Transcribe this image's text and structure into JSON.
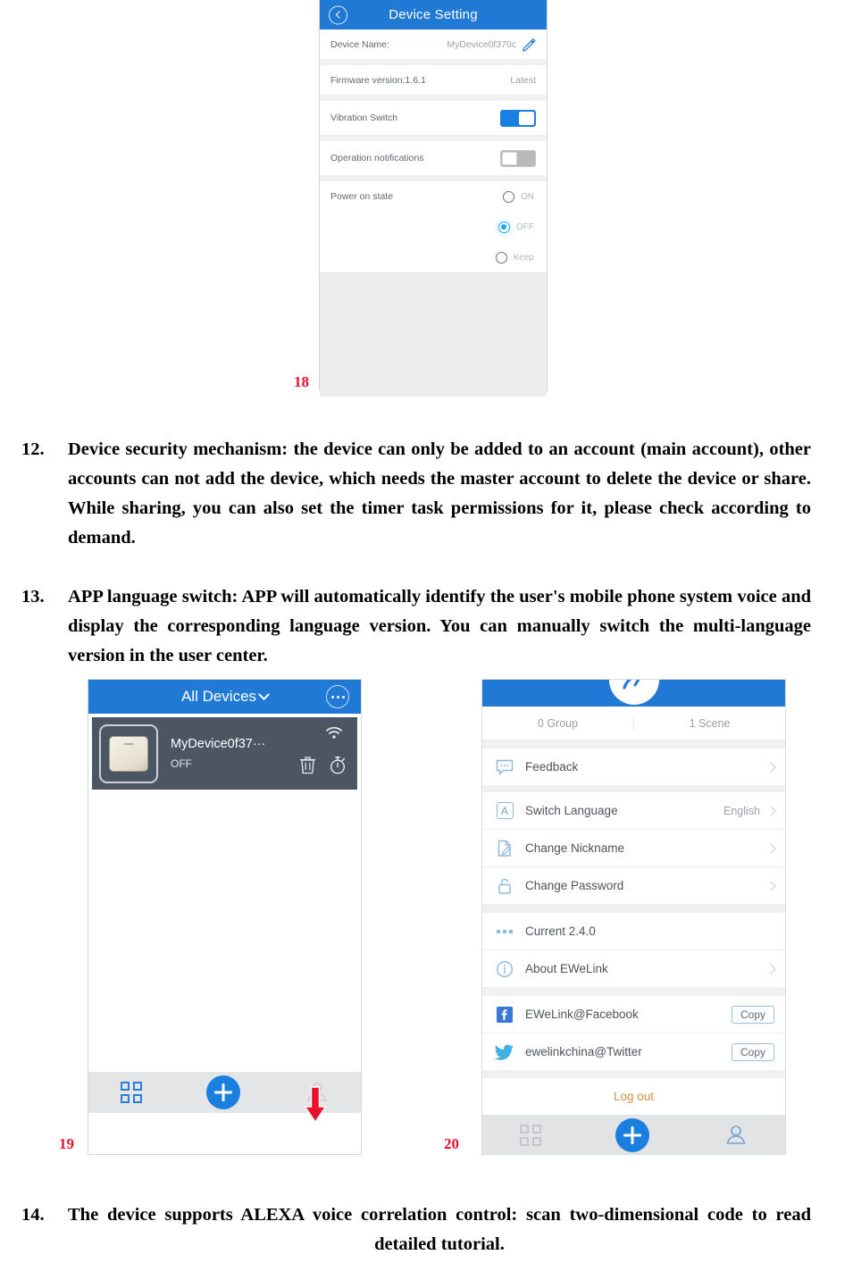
{
  "figure18": {
    "number": "18",
    "header": {
      "title": "Device Setting",
      "back_icon": "chevron-left-icon"
    },
    "rows": [
      {
        "label": "Device Name:",
        "value": "MyDevice0f370c",
        "icon": "pencil-edit-icon"
      },
      {
        "label": "Firmware version:1.6.1",
        "value": "Latest"
      },
      {
        "label": "Vibration Switch",
        "toggle": "on"
      },
      {
        "label": "Operation notifications",
        "toggle": "off"
      }
    ],
    "power_on_state": {
      "label": "Power on state",
      "options": [
        {
          "label": "ON",
          "selected": false
        },
        {
          "label": "OFF",
          "selected": true
        },
        {
          "label": "Keep",
          "selected": false
        }
      ]
    }
  },
  "paragraphs": [
    {
      "number": "12.",
      "text": "Device security mechanism: the device can only be added to an account (main account), other accounts can not add the device, which needs the master account to delete the device or share. While sharing, you can also set the timer task permissions for it, please check according to demand."
    },
    {
      "number": "13.",
      "text": "   APP language switch: APP will automatically identify the user's mobile phone system voice and display the corresponding language version. You can manually switch the multi-language version in the user center."
    },
    {
      "number": "14.",
      "text": "The device supports ALEXA voice correlation control: scan two-dimensional code to read detailed tutorial."
    }
  ],
  "figure19": {
    "number": "19",
    "header": {
      "title": "All Devices",
      "chevron": "chevron-down-icon",
      "more_icon": "more-dots-icon"
    },
    "device": {
      "name": "MyDevice0f37···",
      "state": "OFF",
      "wifi_icon": "wifi-icon",
      "delete_icon": "trash-icon",
      "timer_icon": "timer-icon",
      "thumb_icon": "wall-switch-icon"
    },
    "tabbar": {
      "devices_icon": "grid-icon",
      "add_icon": "plus-icon",
      "profile_icon": "person-icon"
    },
    "annotation": {
      "arrow": "red-down-arrow",
      "points_to": "profile-tab"
    }
  },
  "figure20": {
    "number": "20",
    "avatar_icon": "user-avatar-icon",
    "stats": [
      {
        "label": "0 Group"
      },
      {
        "label": "1 Scene"
      }
    ],
    "rows": [
      {
        "icon": "feedback-bubble-icon",
        "label": "Feedback",
        "value": "",
        "chevron": true
      },
      {
        "icon": "language-a-icon",
        "label": "Switch Language",
        "value": "English",
        "chevron": true
      },
      {
        "icon": "nickname-edit-icon",
        "label": "Change Nickname",
        "value": "",
        "chevron": true
      },
      {
        "icon": "lock-icon",
        "label": "Change Password",
        "value": "",
        "chevron": true
      }
    ],
    "rows2": [
      {
        "icon": "version-dots-icon",
        "label": "Current  2.4.0",
        "value": "",
        "chevron": false
      },
      {
        "icon": "info-circle-icon",
        "label": "About EWeLink",
        "value": "",
        "chevron": true
      }
    ],
    "social": [
      {
        "icon": "facebook-icon",
        "label": "EWeLink@Facebook",
        "button": "Copy"
      },
      {
        "icon": "twitter-icon",
        "label": "ewelinkchina@Twitter",
        "button": "Copy"
      }
    ],
    "logout": "Log out",
    "tabbar": {
      "devices_icon": "grid-icon",
      "add_icon": "plus-icon",
      "profile_icon": "person-icon"
    }
  },
  "colors": {
    "brand_blue": "#2079d4",
    "accent_blue": "#1b7fe0",
    "annotation_red": "#e8112d",
    "card_gray": "#4c5563",
    "logout_orange": "#d8903f"
  }
}
